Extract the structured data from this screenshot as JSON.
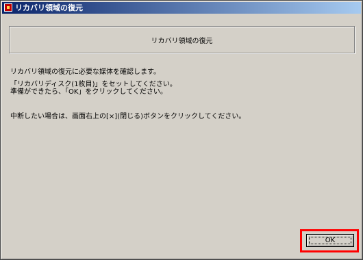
{
  "window": {
    "title": "リカバリ領域の復元"
  },
  "header": {
    "title": "リカバリ領域の復元"
  },
  "body": {
    "line1": "リカバリ領域の復元に必要な媒体を確認します。",
    "line2": "「リカバリディスク(1枚目)」をセットしてください。",
    "line3": "準備ができたら、「OK」をクリックしてください。",
    "line4": "中断したい場合は、画面右上の[×](閉じる)ボタンをクリックしてください。"
  },
  "buttons": {
    "ok_label": "OK"
  },
  "colors": {
    "titlebar_start": "#0a246a",
    "titlebar_end": "#a6caf0",
    "dialog_face": "#d4d0c8",
    "highlight": "#ff0000"
  },
  "icons": {
    "title_icon": "app-icon"
  }
}
